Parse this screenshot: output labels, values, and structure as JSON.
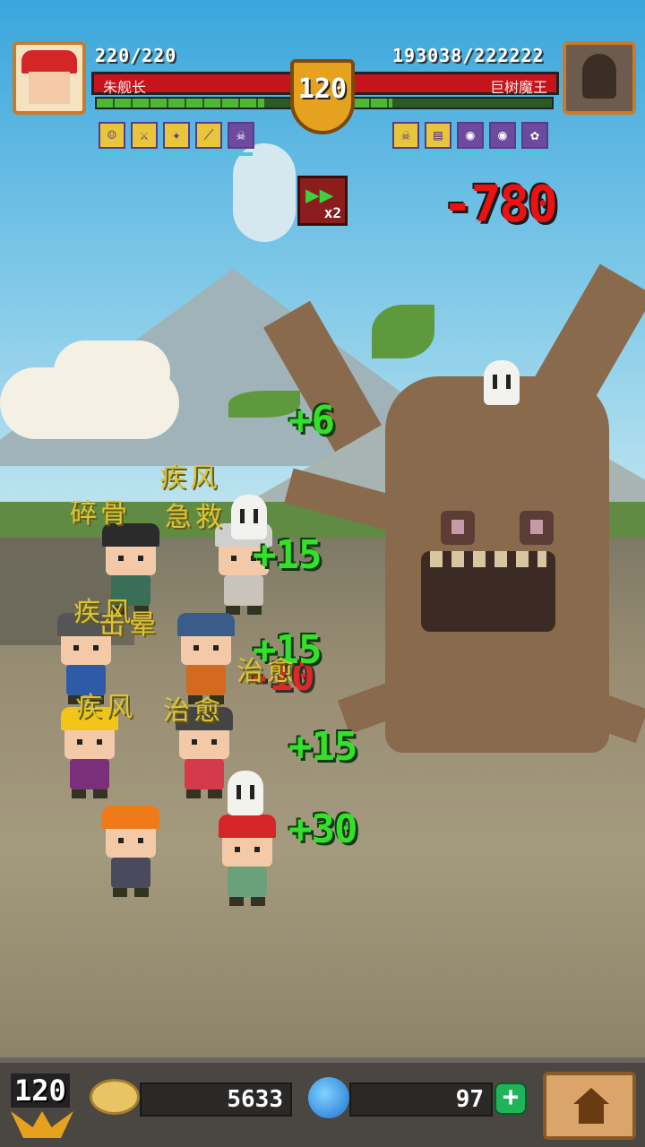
{
  "player": {
    "hp_text": "220/220",
    "name": "朱舰长",
    "hp_fraction": 1.0,
    "energy_fraction": 0.86,
    "skills": [
      "face-skill-icon",
      "sword-skill-icon",
      "kick-skill-icon",
      "slash-skill-icon",
      "ghost-skill-icon"
    ]
  },
  "boss": {
    "hp_text": "193038/222222",
    "name": "巨树魔王",
    "hp_fraction": 0.87,
    "energy_fraction": 0.2,
    "skills": [
      "ghost-skill-icon",
      "stripe-skill-icon",
      "mask-skill-icon",
      "mask-skill-icon",
      "flower-skill-icon"
    ]
  },
  "level": "120",
  "speed": {
    "multiplier": "x2",
    "icon": "fast-forward-icon"
  },
  "damage_numbers": [
    "-780",
    "-10"
  ],
  "heal_numbers": [
    "+6",
    "+15",
    "+15",
    "+15",
    "+30"
  ],
  "skill_texts": [
    "疾风",
    "碎骨",
    "急救",
    "疾风",
    "击晕",
    "治愈",
    "疾风",
    "治愈"
  ],
  "bottom_bar": {
    "level": "120",
    "gold": "5633",
    "gems": "97",
    "plus_label": "+",
    "home_icon": "home-icon"
  },
  "colors": {
    "hp_red": "#c5141c",
    "heal_green": "#33e02a",
    "gold_shield": "#e6a21e"
  }
}
